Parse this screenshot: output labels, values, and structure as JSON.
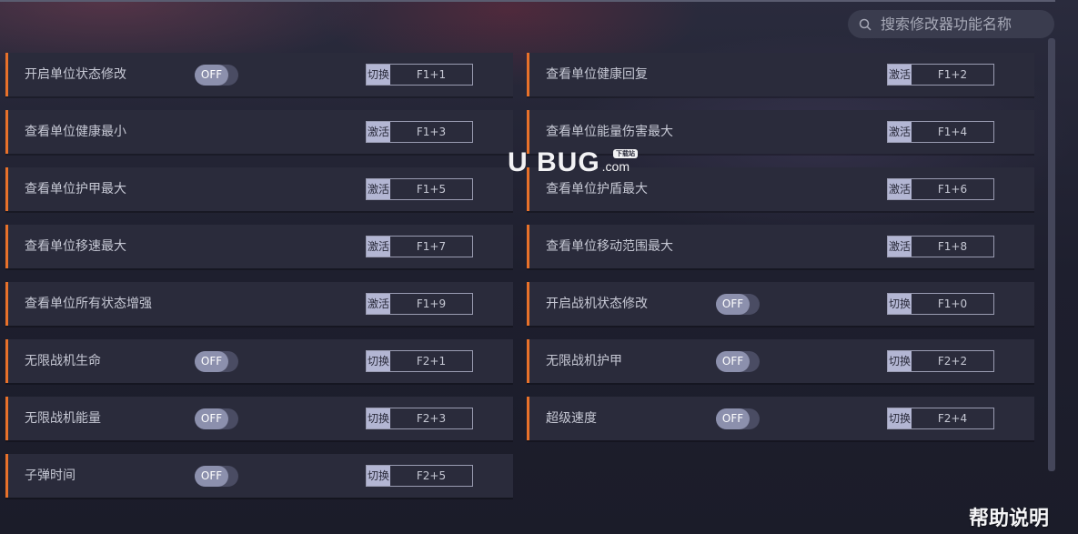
{
  "search": {
    "placeholder": "搜索修改器功能名称"
  },
  "toggle_label": "OFF",
  "watermark": {
    "text": "U BUG",
    "suffix": ".com",
    "tag": "下载站"
  },
  "help_label": "帮助说明",
  "left_column": [
    {
      "label": "开启单位状态修改",
      "toggle": true,
      "mode": "切换",
      "key": "F1+1"
    },
    {
      "label": "查看单位健康最小",
      "toggle": false,
      "mode": "激活",
      "key": "F1+3"
    },
    {
      "label": "查看单位护甲最大",
      "toggle": false,
      "mode": "激活",
      "key": "F1+5"
    },
    {
      "label": "查看单位移速最大",
      "toggle": false,
      "mode": "激活",
      "key": "F1+7"
    },
    {
      "label": "查看单位所有状态增强",
      "toggle": false,
      "mode": "激活",
      "key": "F1+9"
    },
    {
      "label": "无限战机生命",
      "toggle": true,
      "mode": "切换",
      "key": "F2+1"
    },
    {
      "label": "无限战机能量",
      "toggle": true,
      "mode": "切换",
      "key": "F2+3"
    },
    {
      "label": "子弹时间",
      "toggle": true,
      "mode": "切换",
      "key": "F2+5"
    }
  ],
  "right_column": [
    {
      "label": "查看单位健康回复",
      "toggle": false,
      "mode": "激活",
      "key": "F1+2"
    },
    {
      "label": "查看单位能量伤害最大",
      "toggle": false,
      "mode": "激活",
      "key": "F1+4"
    },
    {
      "label": "查看单位护盾最大",
      "toggle": false,
      "mode": "激活",
      "key": "F1+6"
    },
    {
      "label": "查看单位移动范围最大",
      "toggle": false,
      "mode": "激活",
      "key": "F1+8"
    },
    {
      "label": "开启战机状态修改",
      "toggle": true,
      "mode": "切换",
      "key": "F1+0"
    },
    {
      "label": "无限战机护甲",
      "toggle": true,
      "mode": "切换",
      "key": "F2+2"
    },
    {
      "label": "超级速度",
      "toggle": true,
      "mode": "切换",
      "key": "F2+4"
    }
  ],
  "colors": {
    "accent": "#e8712a",
    "row_bg": "#2a2b3b",
    "toggle_knob": "#8c90ad",
    "mode_bg": "#b3b6d3"
  }
}
